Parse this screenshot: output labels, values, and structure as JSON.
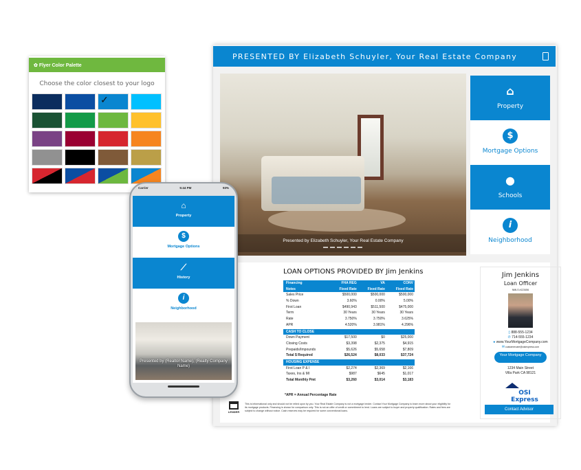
{
  "flyer": {
    "header": "PRESENTED BY Elizabeth Schuyler, Your Real Estate Company",
    "header_icon": "pdf-icon",
    "photo_caption": "Presented by Elizabeth Schuyler, Your Real Estate Company",
    "nav": [
      {
        "label": "Property",
        "icon": "home-icon",
        "active": true
      },
      {
        "label": "Mortgage Options",
        "icon": "dollar-icon",
        "active": false
      },
      {
        "label": "Schools",
        "icon": "apple-icon",
        "active": true
      },
      {
        "label": "Neighborhood",
        "icon": "info-icon",
        "active": false
      }
    ],
    "loan_title": "LOAN OPTIONS PROVIDED BY Jim Jenkins",
    "table": {
      "header": [
        "Financing",
        "FHA REG",
        "VA",
        "CONV"
      ],
      "subheader": [
        "Notes",
        "Fixed Rate",
        "Fixed Rate",
        "Fixed Rate"
      ],
      "rows": [
        [
          "Sales Price",
          "$500,000",
          "$500,000",
          "$500,000"
        ],
        [
          "% Down",
          "3.60%",
          "0.00%",
          "5.00%"
        ],
        [
          "First Loan",
          "$490,943",
          "$511,500",
          "$475,000"
        ],
        [
          "Term",
          "30 Years",
          "30 Years",
          "30 Years"
        ],
        [
          "Rate",
          "3.750%",
          "3.750%",
          "3.625%"
        ],
        [
          "APR",
          "4.520%",
          "3.981%",
          "4.296%"
        ]
      ],
      "cash_section": "CASH TO CLOSE",
      "cash_rows": [
        [
          "Down Payment",
          "$17,500",
          "$0",
          "$25,000"
        ],
        [
          "Closing Costs",
          "$3,398",
          "$2,375",
          "$4,915"
        ],
        [
          "Prepaids/Impounds",
          "$5,626",
          "$5,658",
          "$7,809"
        ]
      ],
      "cash_total": [
        "Total $ Required",
        "$26,524",
        "$8,033",
        "$37,724"
      ],
      "housing_section": "HOUSING EXPENSE",
      "housing_rows": [
        [
          "First Loan P & I",
          "$2,274",
          "$2,369",
          "$2,166"
        ],
        [
          "Taxes, Ins & MI",
          "$987",
          "$645",
          "$1,017"
        ]
      ],
      "housing_total": [
        "Total Monthly Pmt",
        "$3,260",
        "$3,014",
        "$3,183"
      ]
    },
    "apr_note": "*APR = Annual Percentage Rate",
    "ehl_label": "EQUAL HOUSING LENDER",
    "disclaimer": "This is informational only and should not be relied upon by you. Your Real Estate Company is not a mortgage lender. Contact Your Mortgage Company to learn more about your eligibility for its mortgage products. Financing is shown for comparison only. This is not an offer of credit or commitment to lend. Loans are subject to buyer and property qualification. Rates and fees are subject to change without notice. Cash reserves may be required for some conventional loans.",
    "agent": {
      "name": "Jim Jenkins",
      "role": "Loan Officer",
      "nmls": "NMLS #123456",
      "phone1": "888-555-1234",
      "phone2": "714-555-1234",
      "website": "www.YourMortgageCompany.com",
      "email": "customercare@osiexpress.com",
      "company_button": "Your Mortgage Company",
      "address1": "1234 Main Street",
      "address2": "Villa Park CA 98121",
      "logo_text": "OSI Express",
      "contact_button": "Contact Advisor"
    }
  },
  "palette": {
    "title": "Flyer Color Palette",
    "subtitle": "Choose the color closest to your logo",
    "selected_index": 2,
    "swatches": [
      "#0b2d5e",
      "#0b4ea2",
      "#0a86d0",
      "#00c0ff",
      "#1a5234",
      "#139a48",
      "#6db83f",
      "#ffc12b",
      "#7a4385",
      "#9a0132",
      "#d6262f",
      "#f6851f",
      "#919191",
      "#000000",
      "#7f5a39",
      "#bb9f48",
      "#d6262f/#000000",
      "#0b4ea2/#d6262f",
      "#0b4ea2/#6db83f",
      "#0a86d0/#f6851f"
    ]
  },
  "phone": {
    "carrier": "Carrier",
    "time": "5:44 PM",
    "battery": "93%",
    "nav": [
      {
        "label": "Property",
        "icon": "home-icon",
        "active": true
      },
      {
        "label": "Mortgage Options",
        "icon": "dollar-icon",
        "active": false
      },
      {
        "label": "History",
        "icon": "chart-icon",
        "active": true
      },
      {
        "label": "Neighborhood",
        "icon": "info-icon",
        "active": false
      }
    ],
    "photo_caption": "Presented by (Realtor Name), (Realty Company Name)"
  },
  "colors": {
    "brand_blue": "#0a86d0",
    "palette_green": "#6fb83f"
  }
}
